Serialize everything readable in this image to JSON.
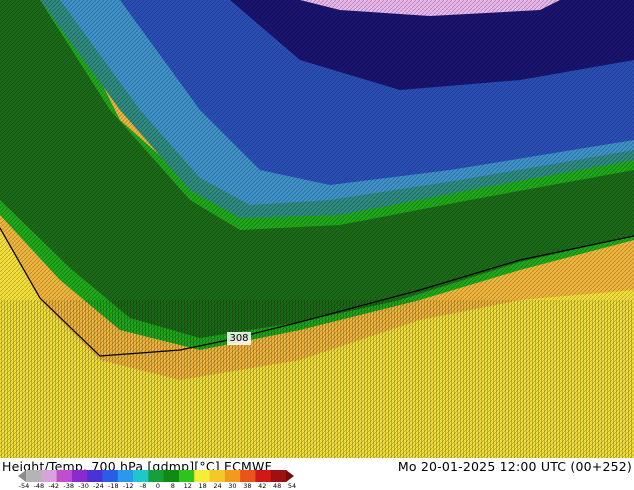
{
  "map": {
    "contour_label": "308",
    "colors": {
      "deep_blue": "#1a1470",
      "blue": "#2a4fb8",
      "cyan_blue": "#3f92c9",
      "teal": "#2f8a80",
      "dark_green": "#1c6b18",
      "green": "#1fa81a",
      "yellow": "#f3e13a",
      "orange_yellow": "#f0b53c",
      "pink": "#e8b6ea"
    }
  },
  "footer": {
    "title": "Height/Temp. 700 hPa [gdmp][°C] ECMWF",
    "valid_time": "Mo 20-01-2025 12:00 UTC (00+252)"
  },
  "colorbar": {
    "ticks": [
      "-54",
      "-48",
      "-42",
      "-38",
      "-30",
      "-24",
      "-18",
      "-12",
      "-8",
      "0",
      "8",
      "12",
      "18",
      "24",
      "30",
      "38",
      "42",
      "48",
      "54"
    ],
    "colors": [
      "#8c8c8c",
      "#b4b4b4",
      "#d7a4d9",
      "#c04fd0",
      "#8a2bd0",
      "#4b32d6",
      "#2a5ce8",
      "#2b98f0",
      "#1fc8c8",
      "#16a03a",
      "#0f8a12",
      "#2ec41e",
      "#f5ee35",
      "#f5c82a",
      "#f09a1e",
      "#e8541a",
      "#d01818",
      "#a01010",
      "#7a0a0a"
    ]
  }
}
